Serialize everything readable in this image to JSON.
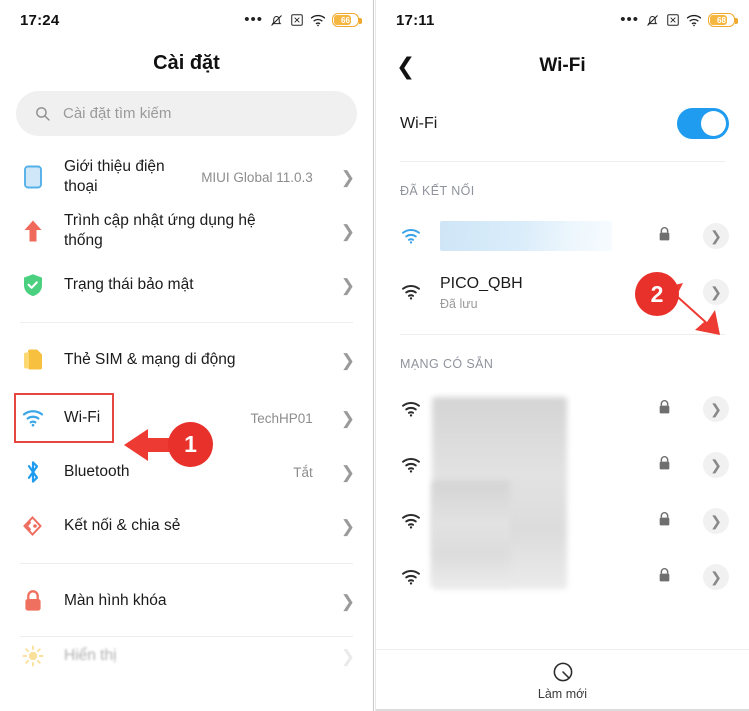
{
  "left": {
    "status": {
      "time": "17:24",
      "dots_icon": "more-dots-icon",
      "mute_icon": "bell-muted-icon",
      "x_icon": "x-box-icon",
      "wifi_icon": "wifi-icon",
      "battery_text": "66"
    },
    "title": "Cài đặt",
    "search": {
      "placeholder": "Cài đặt tìm kiếm",
      "icon": "search-icon"
    },
    "items": [
      {
        "label": "Giới thiệu điện thoại",
        "value": "MIUI Global 11.0.3",
        "icon": "phone-icon",
        "color": "#54b0e8"
      },
      {
        "label": "Trình cập nhật ứng dụng hệ thống",
        "value": "",
        "icon": "arrow-up-icon",
        "color": "#ef6a5b"
      },
      {
        "label": "Trạng thái bảo mật",
        "value": "",
        "icon": "shield-check-icon",
        "color": "#4ad07f"
      },
      {
        "label": "Thẻ SIM & mạng di động",
        "value": "",
        "icon": "sim-card-icon",
        "color": "#f7c13f"
      },
      {
        "label": "Wi-Fi",
        "value": "TechHP01",
        "icon": "wifi-icon",
        "color": "#39a7e8"
      },
      {
        "label": "Bluetooth",
        "value": "Tắt",
        "icon": "bluetooth-icon",
        "color": "#1f9cf0"
      },
      {
        "label": "Kết nối & chia sẻ",
        "value": "",
        "icon": "connection-share-icon",
        "color": "#ee6d5e"
      },
      {
        "label": "Màn hình khóa",
        "value": "",
        "icon": "lock-icon",
        "color": "#f0705f"
      },
      {
        "label": "Hiển thị",
        "value": "",
        "icon": "brightness-icon",
        "color": "#f5c84a"
      }
    ],
    "annotation": {
      "number": "1",
      "target": "Wi-Fi"
    }
  },
  "right": {
    "status": {
      "time": "17:11",
      "battery_text": "68"
    },
    "header": {
      "back_icon": "back-chevron-icon",
      "title": "Wi-Fi"
    },
    "toggle": {
      "label": "Wi-Fi",
      "state": "on"
    },
    "sections": [
      {
        "heading": "ĐÃ KẾT NỐI",
        "networks": [
          {
            "name": "",
            "sub": "",
            "redacted": "blue",
            "locked": true,
            "signal": "wifi-strong-icon",
            "color": "#3ba3e8"
          },
          {
            "name": "PICO_QBH",
            "sub": "Đã lưu",
            "redacted": "none",
            "locked": true,
            "signal": "wifi-strong-icon",
            "color": "#2b2b2b"
          }
        ]
      },
      {
        "heading": "MẠNG CÓ SẴN",
        "networks": [
          {
            "name": "",
            "sub": "",
            "redacted": "gray",
            "locked": true,
            "signal": "wifi-strong-icon",
            "color": "#2b2b2b"
          },
          {
            "name": "",
            "sub": "",
            "redacted": "gray",
            "locked": true,
            "signal": "wifi-strong-icon",
            "color": "#2b2b2b"
          },
          {
            "name": "",
            "sub": "",
            "redacted": "gray",
            "locked": true,
            "signal": "wifi-strong-icon",
            "color": "#2b2b2b"
          },
          {
            "name": "",
            "sub": "",
            "redacted": "gray",
            "locked": true,
            "signal": "wifi-strong-icon",
            "color": "#2b2b2b"
          }
        ]
      }
    ],
    "refresh": {
      "label": "Làm mới",
      "icon": "refresh-scan-icon"
    },
    "annotation": {
      "number": "2",
      "target": "PICO_QBH detail arrow"
    }
  },
  "colors": {
    "accent_blue": "#1f9cf0",
    "annotation_red": "#e8312a",
    "highlight_red": "#e5463f"
  }
}
